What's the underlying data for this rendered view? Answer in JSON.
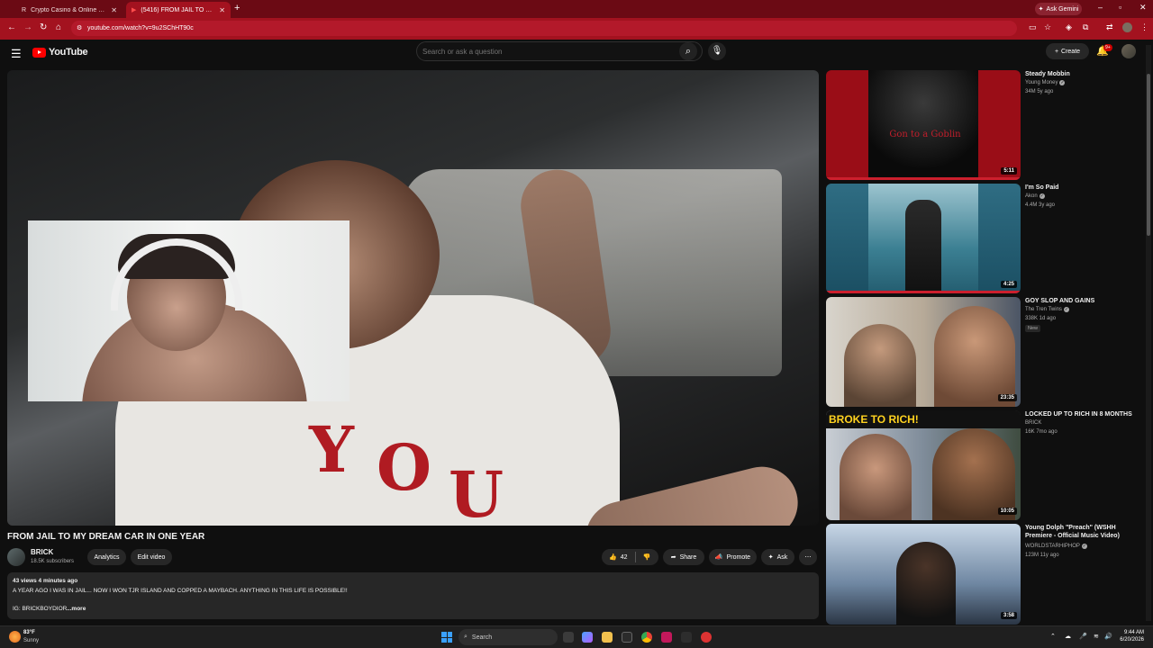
{
  "browser": {
    "tabs": [
      {
        "title": "Crypto Casino & Online Gambli..."
      },
      {
        "title": "(5416) FROM JAIL TO MY DREA..."
      }
    ],
    "new_tab": "+",
    "gemini_label": "Ask Gemini",
    "url": "youtube.com/watch?v=9u2SChHT90c"
  },
  "youtube": {
    "logo_text": "YouTube",
    "search_placeholder": "Search or ask a question",
    "create_label": "Create",
    "notif_count": "9+"
  },
  "video": {
    "title": "FROM JAIL TO MY DREAM CAR IN ONE YEAR",
    "channel": "BRICK",
    "subscribers": "18.5K subscribers",
    "analytics_label": "Analytics",
    "edit_label": "Edit video",
    "likes": "42",
    "share_label": "Share",
    "promote_label": "Promote",
    "ask_label": "Ask",
    "description": {
      "meta": "43 views  4 minutes ago",
      "text": "A YEAR AGO I WAS IN JAIL... NOW I WON TJR ISLAND AND COPPED A MAYBACH. ANYTHING IN THIS LIFE IS POSSIBLE!!",
      "ig": "IG: BRICKBOYDIOR",
      "more": "...more"
    }
  },
  "recommendations": [
    {
      "title": "Steady Mobbin",
      "channel": "Young Money",
      "stats": "34M   5y ago",
      "duration": "5:11",
      "thumb_text": "Gon to a Goblin"
    },
    {
      "title": "I'm So Paid",
      "channel": "Akon",
      "stats": "4.4M   3y ago",
      "duration": "4:25",
      "thumb_text": ""
    },
    {
      "title": "GOY SLOP AND GAINS",
      "channel": "The Tren Twins",
      "stats": "338K   1d ago",
      "duration": "23:35",
      "badge": "New"
    },
    {
      "title": "LOCKED UP TO RICH IN 8 MONTHS",
      "channel": "BRICK",
      "stats": "16K   7mo ago",
      "duration": "10:05",
      "thumb_text": "BROKE TO RICH!"
    },
    {
      "title": "Young Dolph \"Preach\" (WSHH Premiere - Official Music Video)",
      "channel": "WORLDSTARHIPHOP",
      "stats": "123M   11y ago",
      "duration": "3:58"
    }
  ],
  "taskbar": {
    "temp": "83°F",
    "condition": "Sunny",
    "search_label": "Search",
    "time": "9:44 AM",
    "date": "6/20/2026"
  },
  "colors": {
    "browser_tab_bar": "#6b0a14",
    "browser_active": "#a3121f",
    "yt_red": "#ff0000",
    "progress_red": "#cc1f2d"
  }
}
